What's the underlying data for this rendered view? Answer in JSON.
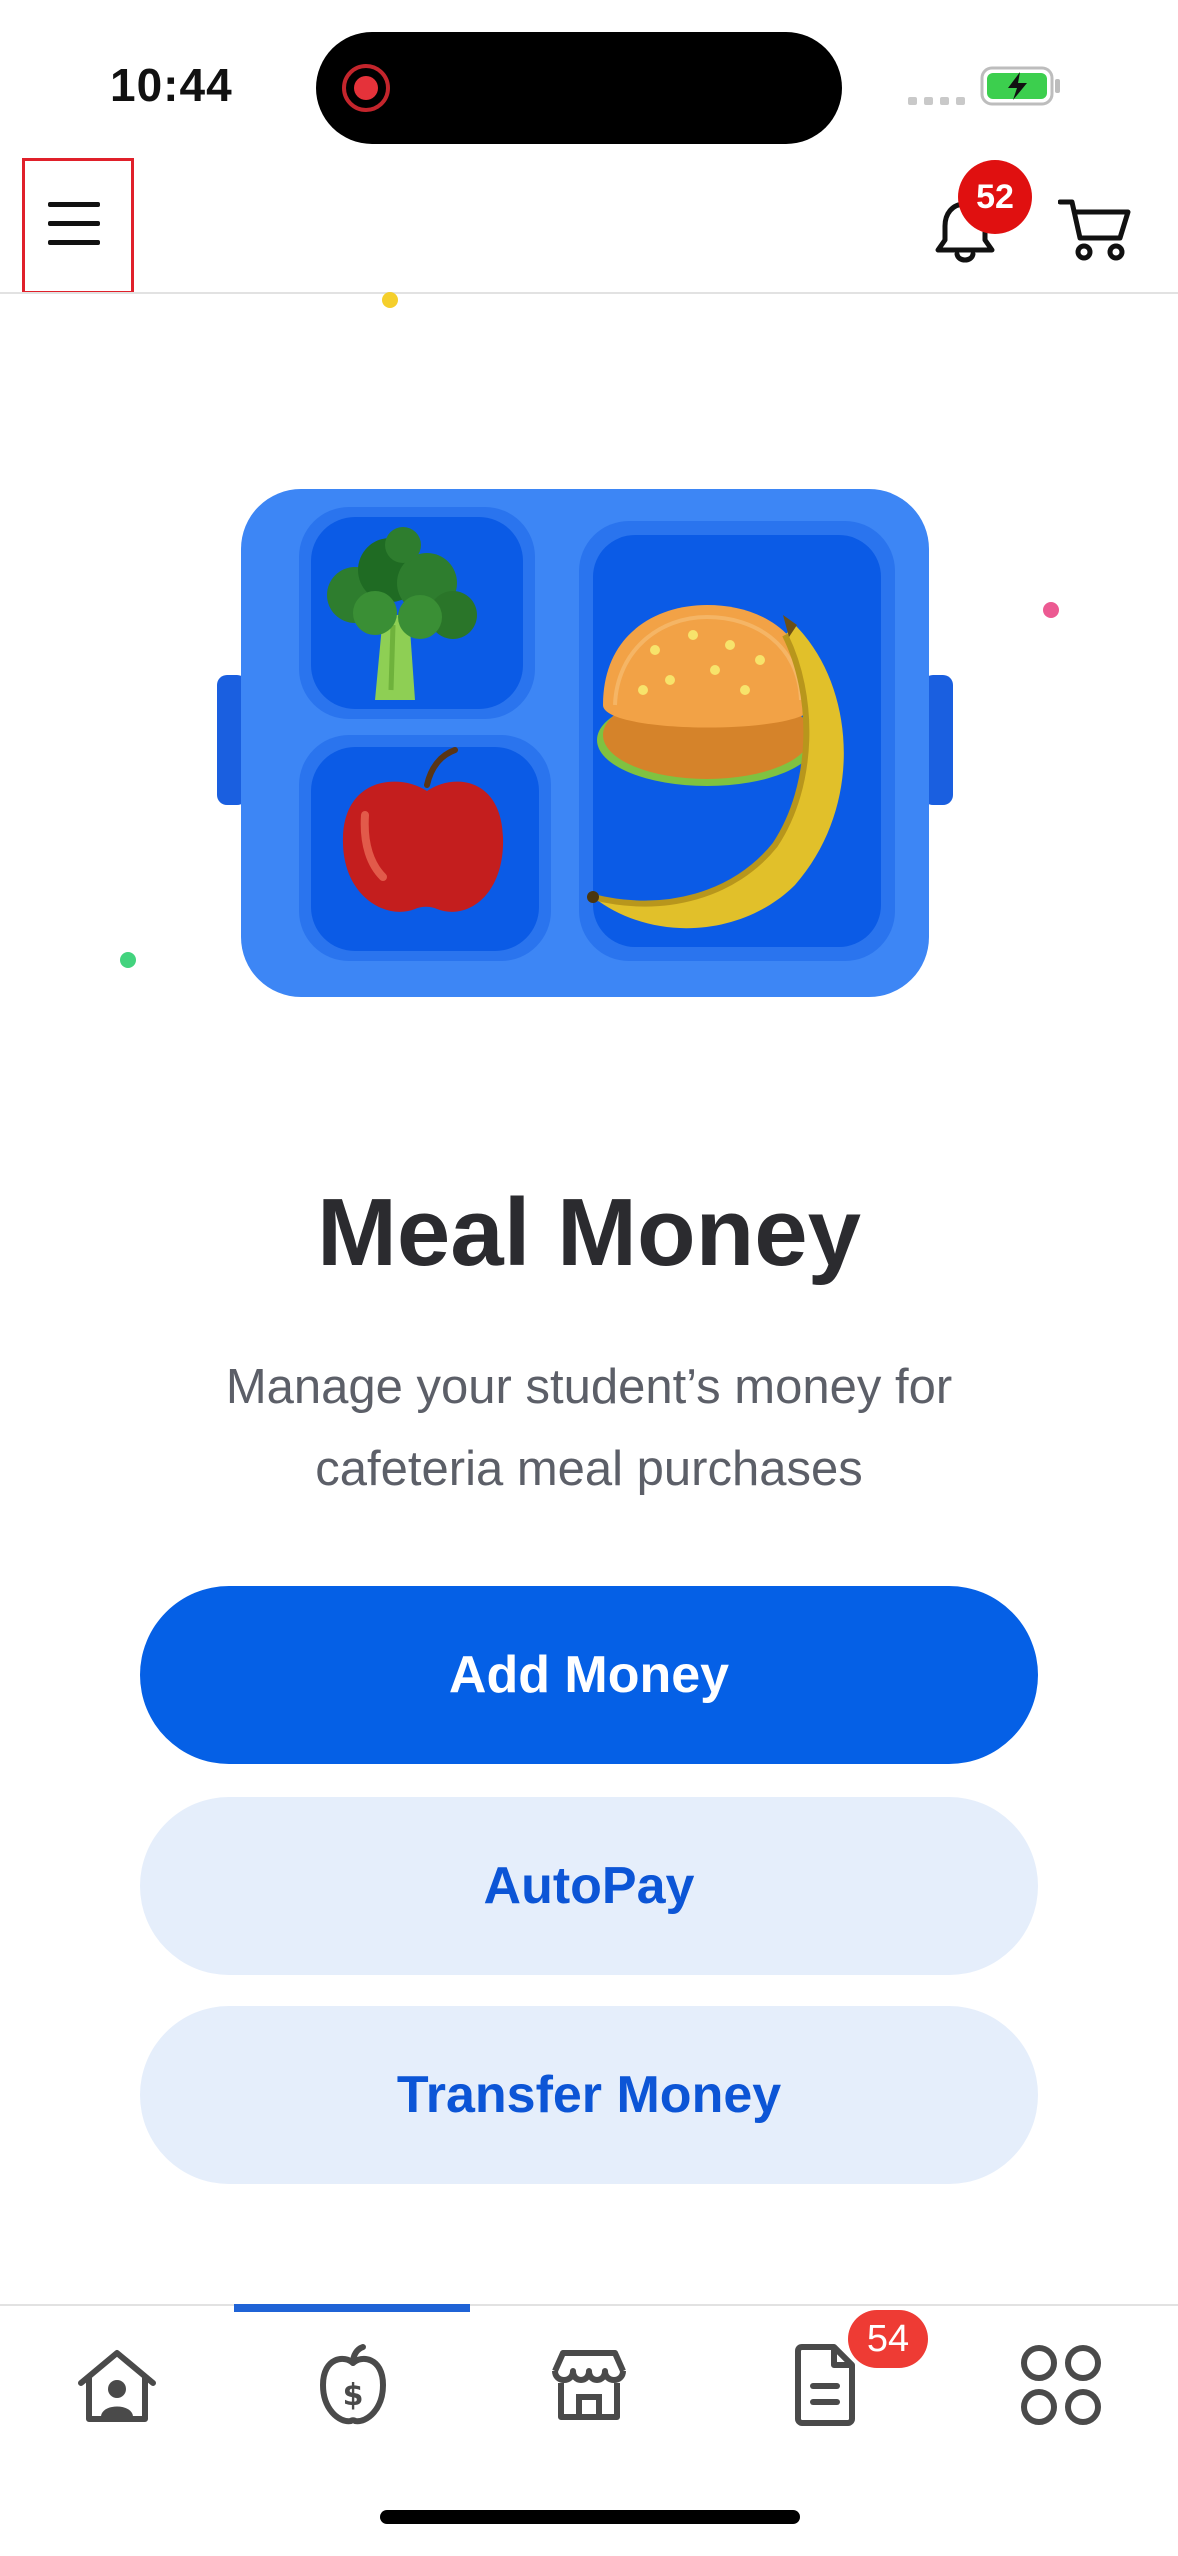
{
  "status_bar": {
    "time": "10:44"
  },
  "header": {
    "notification_count": "52"
  },
  "hero": {
    "title": "Meal Money",
    "subtitle_line1": "Manage your student’s money for",
    "subtitle_line2": "cafeteria meal purchases"
  },
  "actions": {
    "add_money": "Add Money",
    "autopay": "AutoPay",
    "transfer_money": "Transfer Money"
  },
  "bottom_nav": {
    "items": [
      {
        "icon": "home-icon"
      },
      {
        "icon": "apple-money-icon",
        "active": true
      },
      {
        "icon": "store-icon"
      },
      {
        "icon": "document-icon",
        "badge": "54"
      },
      {
        "icon": "apps-grid-icon"
      }
    ]
  },
  "colors": {
    "primary": "#0560e6",
    "secondary_button_bg": "#e5eefb",
    "badge_red": "#e01010",
    "tray_blue": "#3d86f5"
  }
}
